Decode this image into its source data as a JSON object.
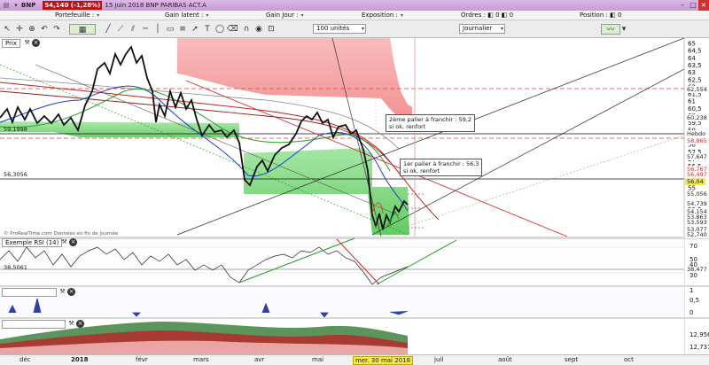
{
  "titlebar": {
    "symbol": "BNP",
    "price": "54,140 (-1,28%)",
    "subtitle": "15 juin 2018 BNP PARIBAS ACT.A"
  },
  "infobar": {
    "portefeuille": "Portefeuille :",
    "gain_latent": "Gain latent :",
    "gain_jour": "Gain Jour :",
    "exposition": "Exposition :",
    "ordres": "Ordres :",
    "ordres_value": "0",
    "position": "Position :",
    "position_value": "0"
  },
  "toolbar": {
    "quantity": "100 unités",
    "period": "Journalier"
  },
  "panels": {
    "price_label": "Prix",
    "provider_note": "© ProRealTime.com Données en fin de journée",
    "rsi_label": "Exemple RSI (14)"
  },
  "annotations": {
    "note1_line1": "2ème palier à franchir : 59,2",
    "note1_line2": "si ok, renfort",
    "note2_line1": "1er palier à franchir : 56,3",
    "note2_line2": "si ok, renfort",
    "left_level1": "59,1998",
    "left_level2": "56,3056",
    "rsi_left_level": "38,5061"
  },
  "price_axis": {
    "ticks": [
      "65",
      "64,5",
      "64",
      "63,5",
      "63",
      "62,5",
      "62",
      "61,5",
      "61",
      "60,5",
      "60",
      "59,5",
      "59",
      "58,5",
      "58",
      "57,5",
      "57",
      "56,5",
      "56",
      "55,5",
      "55",
      "54,5",
      "54",
      "53,5",
      "53",
      "52,5",
      "52"
    ],
    "tags": [
      {
        "text": "62,554",
        "bg": "#ffffff",
        "fg": "#222222"
      },
      {
        "text": "60,238",
        "bg": "#ffffff",
        "fg": "#222222"
      },
      {
        "text": "Hebdo",
        "bg": "#ffffff",
        "fg": "#222222"
      },
      {
        "text": "58,865",
        "bg": "#ffffff",
        "fg": "#c03030"
      },
      {
        "text": "57,647",
        "bg": "#ffffff",
        "fg": "#222222"
      },
      {
        "text": "56,767",
        "bg": "#ffffff",
        "fg": "#c03030"
      },
      {
        "text": "56,497",
        "bg": "#ffffff",
        "fg": "#c03030"
      },
      {
        "text": "56,04",
        "bg": "#f6e94a",
        "fg": "#111111"
      },
      {
        "text": "55,056",
        "bg": "#ffffff",
        "fg": "#222222"
      },
      {
        "text": "54,739",
        "bg": "#ffffff",
        "fg": "#222222"
      },
      {
        "text": "54,154",
        "bg": "#ffffff",
        "fg": "#222222"
      },
      {
        "text": "53,863",
        "bg": "#ffffff",
        "fg": "#222222"
      },
      {
        "text": "53,593",
        "bg": "#ffffff",
        "fg": "#222222"
      },
      {
        "text": "53,077",
        "bg": "#ffffff",
        "fg": "#222222"
      },
      {
        "text": "52,740",
        "bg": "#ffffff",
        "fg": "#222222"
      }
    ]
  },
  "rsi_axis": {
    "ticks": [
      "70",
      "50",
      "40",
      "30"
    ],
    "tag": "38,477"
  },
  "vol_axis": {
    "ticks": [
      "1",
      "0,5",
      "0"
    ]
  },
  "bottom_axis": {
    "ticks": [
      "12,956",
      "12,737"
    ]
  },
  "months": [
    "déc",
    "2018",
    "févr",
    "mars",
    "avr",
    "mai",
    "mer. 30 mai 2018",
    "juil",
    "août",
    "sept",
    "oct"
  ],
  "colors": {
    "accent": "#c89ad6",
    "price_down": "#b81414",
    "green_zone": "#6ad26a",
    "red_zone": "#f59a9a"
  }
}
